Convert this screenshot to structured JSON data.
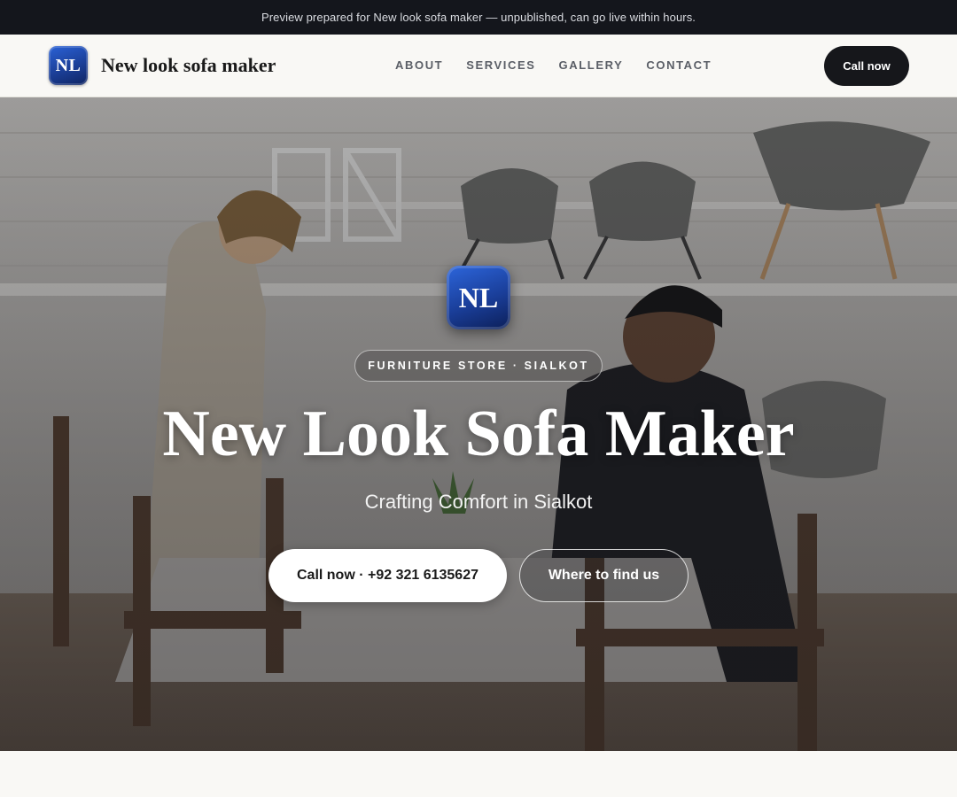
{
  "preview_banner": {
    "text": "Preview prepared for New look sofa maker — unpublished, can go live within hours."
  },
  "header": {
    "logo_initials": "NL",
    "brand_name": "New look sofa maker",
    "nav": [
      "ABOUT",
      "SERVICES",
      "GALLERY",
      "CONTACT"
    ],
    "cta_label": "Call now"
  },
  "hero": {
    "logo_initials": "NL",
    "eyebrow": "FURNITURE STORE · SIALKOT",
    "title": "New Look Sofa Maker",
    "subtitle": "Crafting Comfort in Sialkot",
    "primary_button": "Call now · +92 321 6135627",
    "secondary_button": "Where to find us"
  },
  "colors": {
    "dark": "#14161c",
    "page_background": "#f9f8f5",
    "logo_blue": "#1b3f98",
    "nav_text": "#5a5e66"
  }
}
